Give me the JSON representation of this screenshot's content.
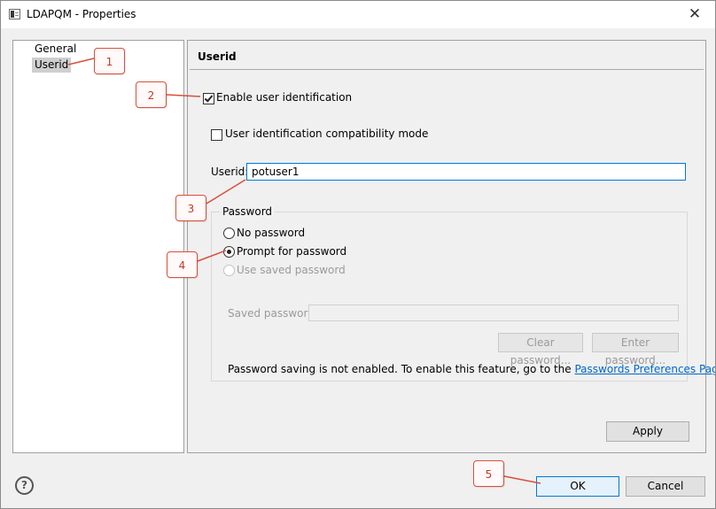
{
  "window": {
    "title": "LDAPQM - Properties",
    "close_glyph": "✕",
    "icon": "properties-window-icon"
  },
  "tree": {
    "items": [
      {
        "label": "General",
        "selected": false
      },
      {
        "label": "Userid",
        "selected": true
      }
    ]
  },
  "page": {
    "title": "Userid",
    "enable_user_identification": {
      "label": "Enable user identification",
      "checked": true
    },
    "compatibility_mode": {
      "label": "User identification compatibility mode",
      "checked": false
    },
    "userid": {
      "label": "Userid:",
      "value": "potuser1"
    },
    "password_group": {
      "label": "Password",
      "options": [
        {
          "label": "No password",
          "selected": false,
          "enabled": true
        },
        {
          "label": "Prompt for password",
          "selected": true,
          "enabled": true
        },
        {
          "label": "Use saved password",
          "selected": false,
          "enabled": false
        }
      ],
      "saved_password_label": "Saved password:",
      "saved_password_value": "",
      "clear_button": "Clear password...",
      "enter_button": "Enter password...",
      "note_text": "Password saving is not enabled.  To enable this feature, go to the ",
      "note_link": "Passwords Preferences Page",
      "note_end": "."
    },
    "apply_button": "Apply"
  },
  "footer": {
    "help_glyph": "?",
    "ok_button": "OK",
    "cancel_button": "Cancel"
  },
  "callouts": [
    "1",
    "2",
    "3",
    "4",
    "5"
  ],
  "colors": {
    "callout_border": "#d94f3a",
    "link": "#0066cc",
    "focus": "#0078d7"
  }
}
